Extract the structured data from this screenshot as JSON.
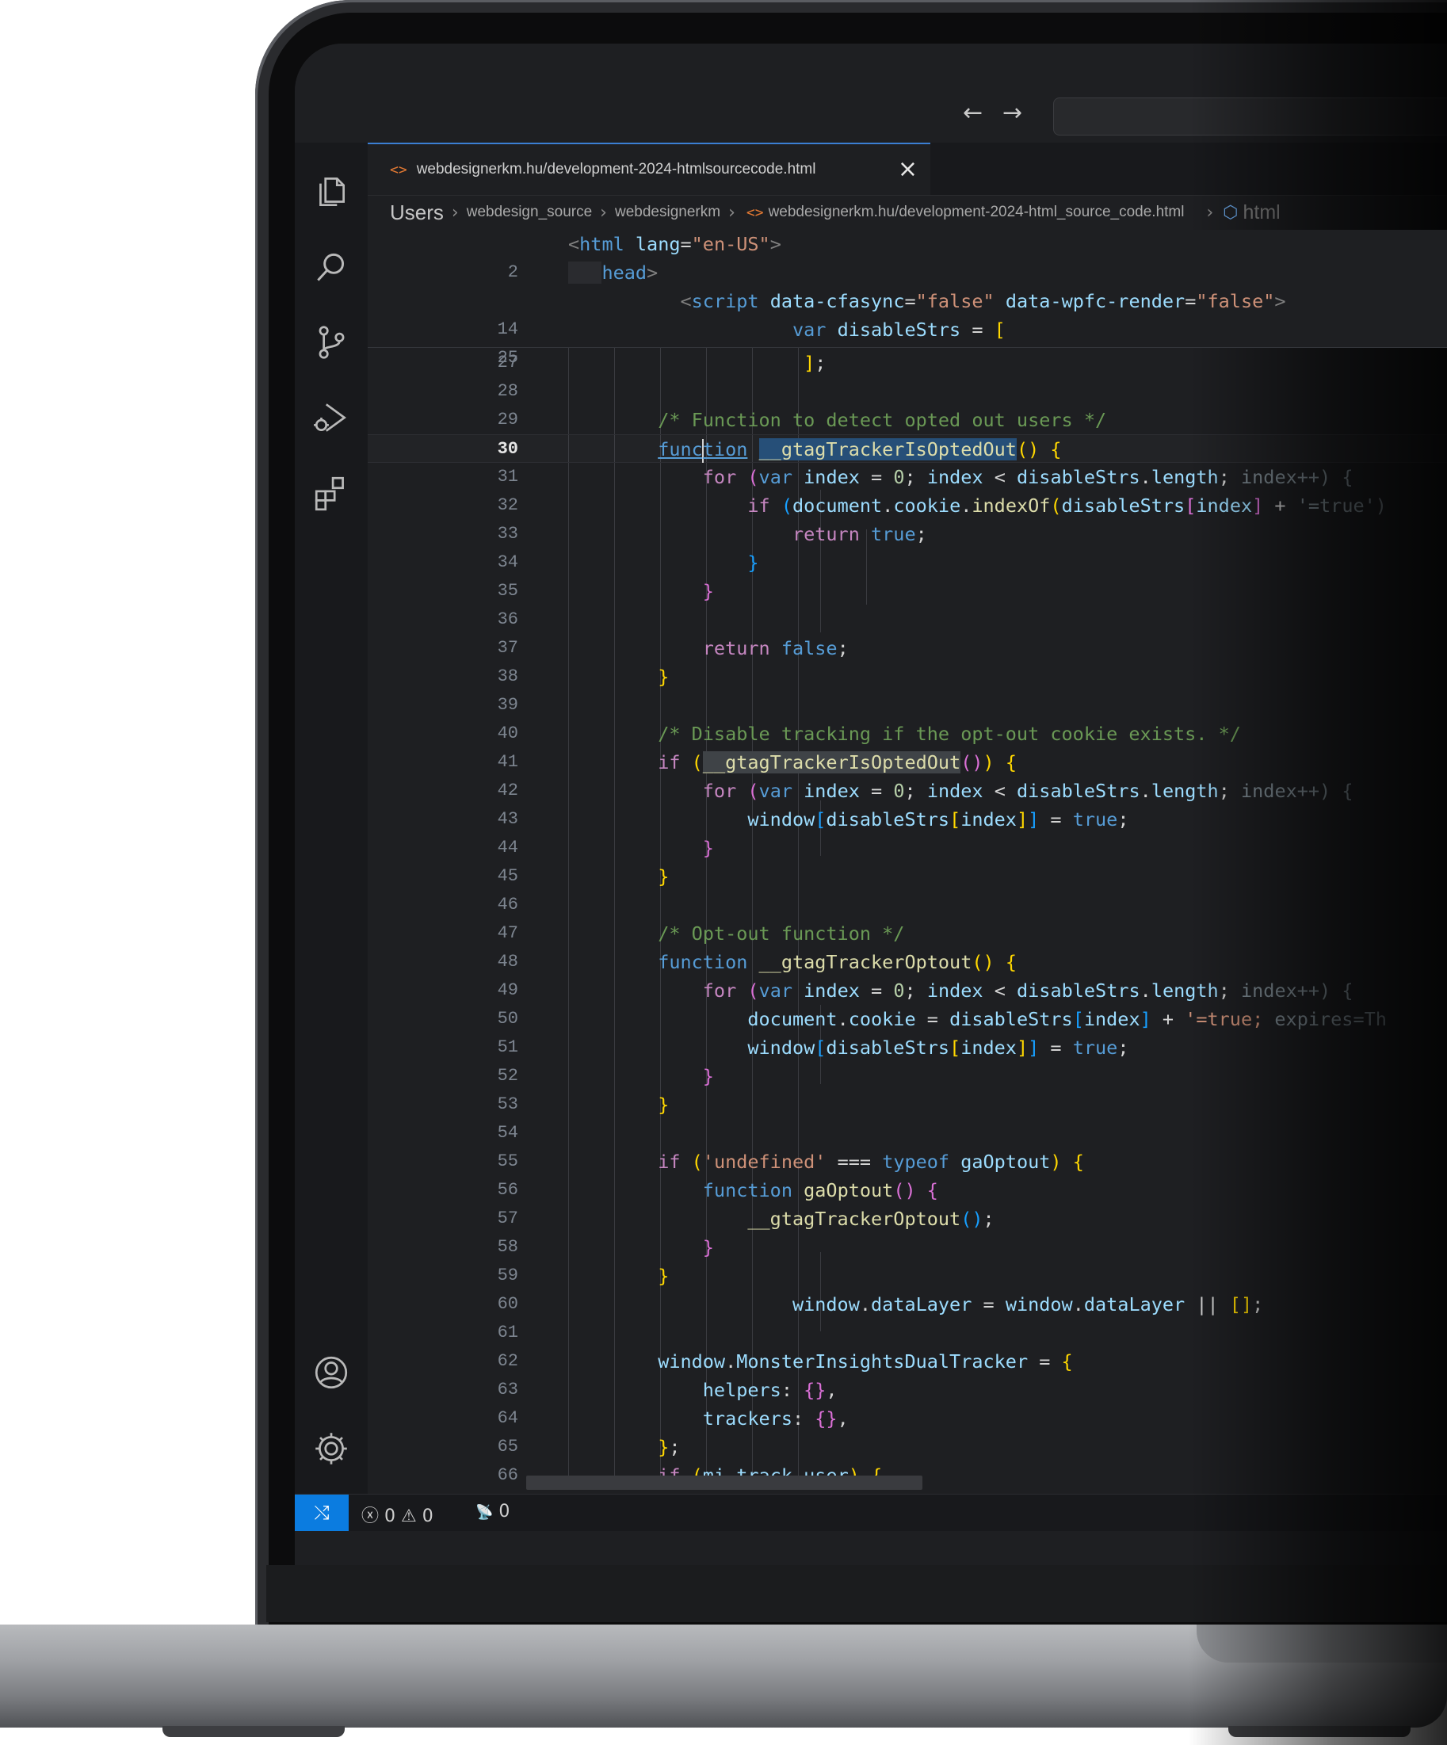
{
  "tab": {
    "file_icon": "<>",
    "title": "webdesignerkm.hu/development-2024-htmlsourcecode.html",
    "close_icon": "×"
  },
  "nav": {
    "back": "←",
    "forward": "→"
  },
  "breadcrumbs": {
    "items": [
      "Users",
      "webdesign_source",
      "webdesignerkm"
    ],
    "file_icon": "<>",
    "file": "webdesignerkm.hu/development-2024-html_source_code.html",
    "symbol_icon": "⬡",
    "symbol": "html",
    "separator": "›"
  },
  "editor": {
    "active_line": "30",
    "sticky": [
      {
        "n": "2"
      },
      {
        "n": ""
      },
      {
        "n": "14"
      },
      {
        "n": "25"
      }
    ],
    "lines": [
      "27",
      "28",
      "29",
      "30",
      "31",
      "32",
      "33",
      "34",
      "35",
      "36",
      "37",
      "38",
      "39",
      "40",
      "41",
      "42",
      "43",
      "44",
      "45",
      "46",
      "47",
      "48",
      "49",
      "50",
      "51",
      "52",
      "53",
      "54",
      "55",
      "56",
      "57",
      "58",
      "59",
      "60",
      "61",
      "62",
      "63",
      "64",
      "65",
      "66"
    ]
  },
  "status": {
    "remote_icon": "⤭",
    "errors_icon": "ⓧ",
    "errors": "0",
    "warnings_icon": "⚠",
    "warnings": "0",
    "ports_icon": "📡",
    "ports": "0"
  },
  "icons": {
    "explorer": "files-icon",
    "search": "search-icon",
    "scm": "source-control-icon",
    "debug": "run-debug-icon",
    "extensions": "extensions-icon",
    "account": "account-icon",
    "settings": "gear-icon"
  }
}
